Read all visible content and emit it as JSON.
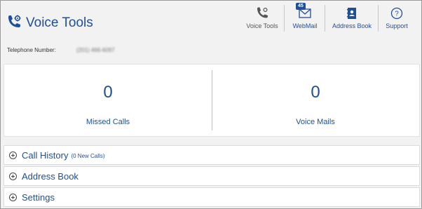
{
  "app": {
    "title": "Voice Tools",
    "icon": "phone-gear-icon"
  },
  "nav": [
    {
      "label": "Voice Tools",
      "icon": "phone-icon"
    },
    {
      "label": "WebMail",
      "icon": "mail-icon",
      "badge": "45"
    },
    {
      "label": "Address Book",
      "icon": "address-book-icon"
    },
    {
      "label": "Support",
      "icon": "help-icon"
    }
  ],
  "telephone": {
    "label": "Telephone Number:",
    "value": "(201) 466-6097"
  },
  "stats": {
    "missed_calls": {
      "count": "0",
      "label": "Missed Calls"
    },
    "voice_mails": {
      "count": "0",
      "label": "Voice Mails"
    }
  },
  "sections": [
    {
      "title": "Call History",
      "note": "(0 New Calls)"
    },
    {
      "title": "Address Book"
    },
    {
      "title": "Settings"
    }
  ],
  "colors": {
    "accent": "#1f4f95",
    "background": "#f2f2f2",
    "card": "#ffffff"
  }
}
